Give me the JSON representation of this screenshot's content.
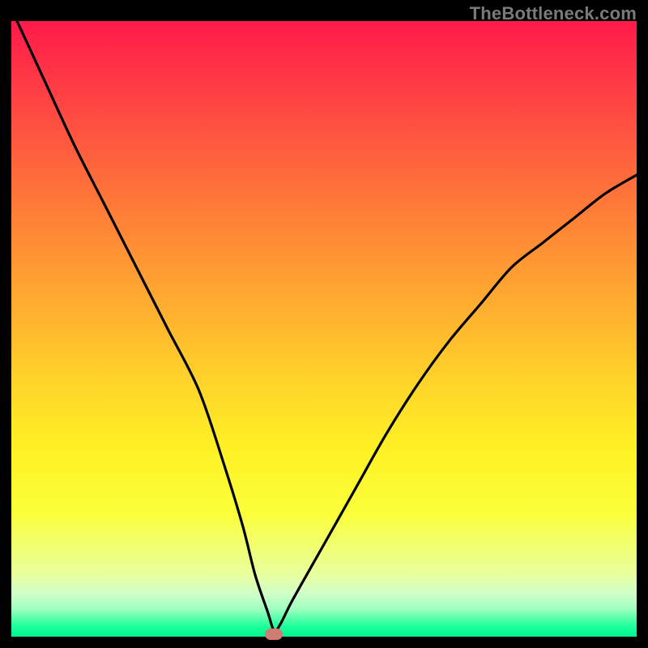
{
  "watermark": "TheBottleneck.com",
  "chart_data": {
    "type": "line",
    "title": "",
    "xlabel": "",
    "ylabel": "",
    "xlim": [
      0,
      100
    ],
    "ylim": [
      0,
      100
    ],
    "x": [
      0,
      5,
      10,
      15,
      20,
      25,
      30,
      34,
      37,
      39,
      41,
      42,
      43,
      45,
      50,
      55,
      60,
      65,
      70,
      75,
      80,
      85,
      90,
      95,
      100
    ],
    "values": [
      102,
      91,
      80,
      70,
      60,
      50,
      40,
      28,
      18,
      10,
      4,
      1,
      2,
      6,
      15,
      24,
      33,
      41,
      48,
      54,
      60,
      64,
      68,
      72,
      75
    ],
    "marker": {
      "x": 42,
      "y": 0
    },
    "grid": false,
    "legend": false
  }
}
